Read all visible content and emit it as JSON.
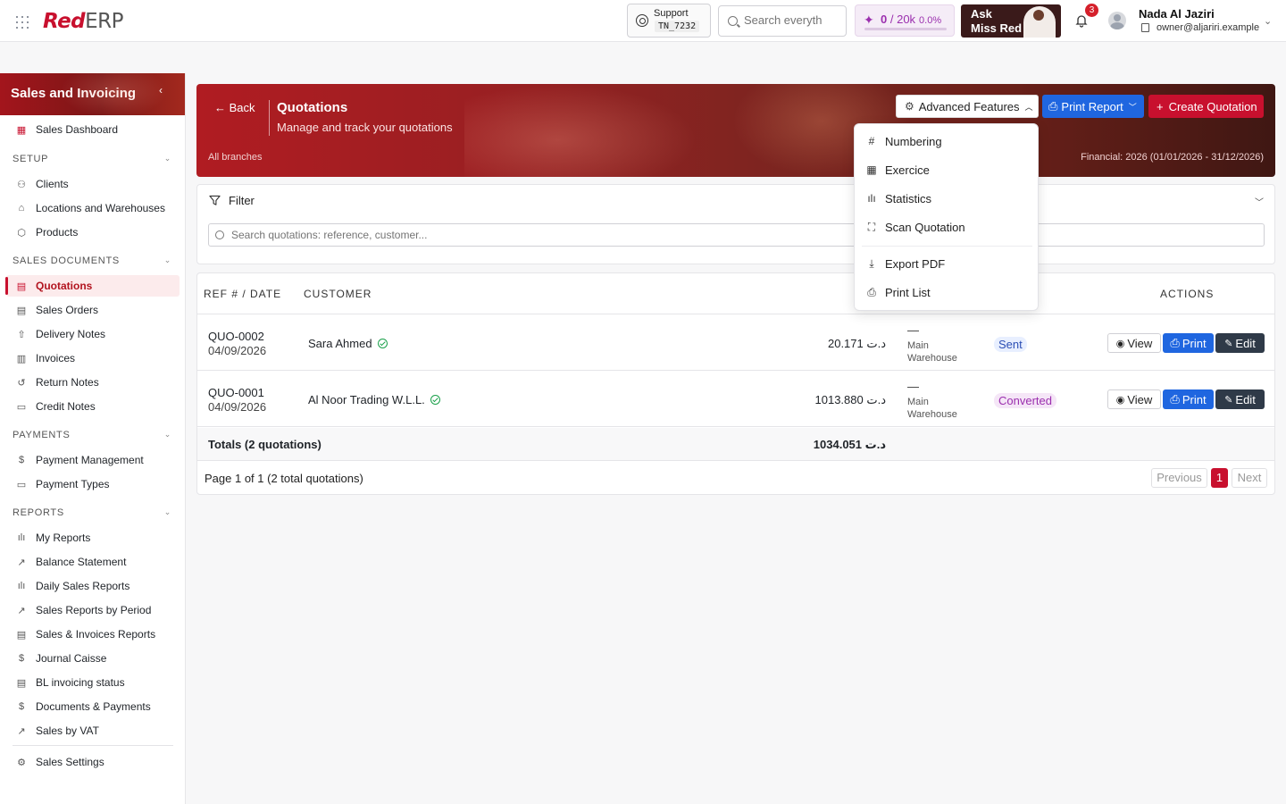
{
  "topbar": {
    "logo_red": "Red",
    "logo_grey": "ERP",
    "support_label": "Support",
    "support_code": "TN_7232",
    "search_placeholder": "Search everyth",
    "ai_used": "0",
    "ai_limit": "/ 20k",
    "ai_percent": "0.0%",
    "ask_line1": "Ask",
    "ask_line2": "Miss Red",
    "notifications_count": "3",
    "user_name": "Nada Al Jaziri",
    "user_email": "owner@aljariri.example"
  },
  "sidebar": {
    "title": "Sales and Invoicing",
    "dashboard": "Sales Dashboard",
    "sections": {
      "setup": "SETUP",
      "sales_documents": "SALES DOCUMENTS",
      "payments": "PAYMENTS",
      "reports": "REPORTS"
    },
    "setup_items": [
      "Clients",
      "Locations and Warehouses",
      "Products"
    ],
    "sales_items": [
      "Quotations",
      "Sales Orders",
      "Delivery Notes",
      "Invoices",
      "Return Notes",
      "Credit Notes"
    ],
    "payment_items": [
      "Payment Management",
      "Payment Types"
    ],
    "report_items": [
      "My Reports",
      "Balance Statement",
      "Daily Sales Reports",
      "Sales Reports by Period",
      "Sales & Invoices Reports",
      "Journal Caisse",
      "BL invoicing status",
      "Documents & Payments",
      "Sales by VAT"
    ],
    "settings": "Sales Settings"
  },
  "header": {
    "back": "Back",
    "title": "Quotations",
    "subtitle": "Manage and track your quotations",
    "branches": "All branches",
    "financial": "Financial: 2026 (01/01/2026 - 31/12/2026)",
    "advanced_label": "Advanced Features",
    "print_label": "Print Report",
    "create_label": "Create Quotation"
  },
  "advanced_menu": {
    "items": [
      "Numbering",
      "Exercice",
      "Statistics",
      "Scan Quotation",
      "Export PDF",
      "Print List"
    ]
  },
  "filter": {
    "title": "Filter",
    "placeholder": "Search quotations: reference, customer..."
  },
  "table": {
    "headers": {
      "ref": "REF # / DATE",
      "customer": "CUSTOMER",
      "actions": "ACTIONS"
    },
    "rows": [
      {
        "ref": "QUO-0002",
        "date": "04/09/2026",
        "customer": "Sara Ahmed",
        "amount": "20.171 د.ت",
        "dash": "—",
        "warehouse1": "Main",
        "warehouse2": "Warehouse",
        "status": "Sent"
      },
      {
        "ref": "QUO-0001",
        "date": "04/09/2026",
        "customer": "Al Noor Trading W.L.L.",
        "amount": "1013.880 د.ت",
        "dash": "—",
        "warehouse1": "Main",
        "warehouse2": "Warehouse",
        "status": "Converted"
      }
    ],
    "view_label": "View",
    "print_label": "Print",
    "edit_label": "Edit",
    "totals_label": "Totals (2 quotations)",
    "totals_value": "1034.051 د.ت"
  },
  "pagination": {
    "info": "Page 1 of 1 (2 total quotations)",
    "previous": "Previous",
    "current": "1",
    "next": "Next"
  }
}
